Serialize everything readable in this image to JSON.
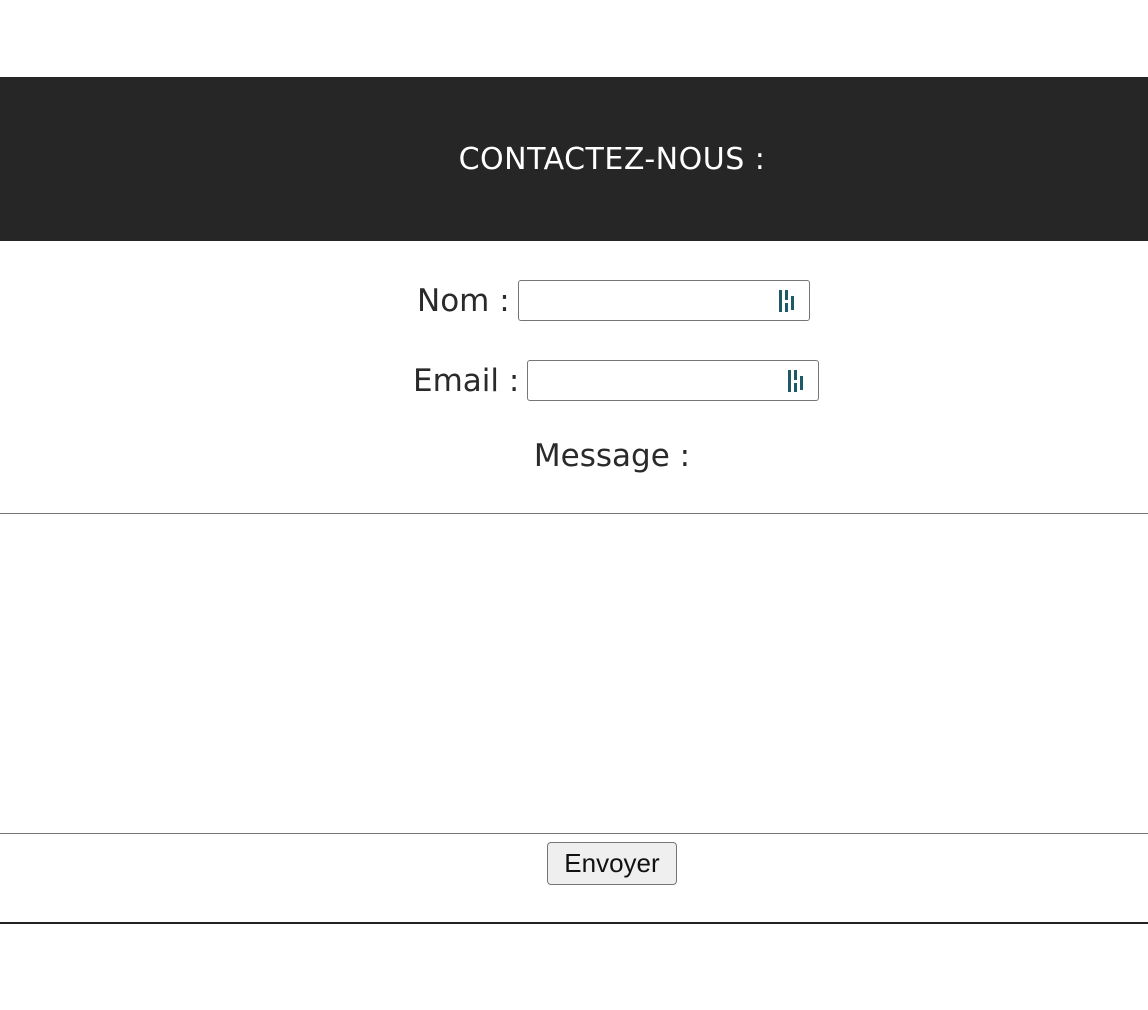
{
  "header": {
    "title": "CONTACTEZ-NOUS :"
  },
  "form": {
    "name_label": "Nom :",
    "name_value": "",
    "email_label": "Email :",
    "email_value": "",
    "message_label": "Message :",
    "message_value": "",
    "submit_label": "Envoyer"
  },
  "icons": {
    "field_autofill": "password-manager-icon"
  },
  "colors": {
    "header_bg": "#262626",
    "header_text": "#ffffff",
    "icon_accent": "#1e5a66"
  }
}
